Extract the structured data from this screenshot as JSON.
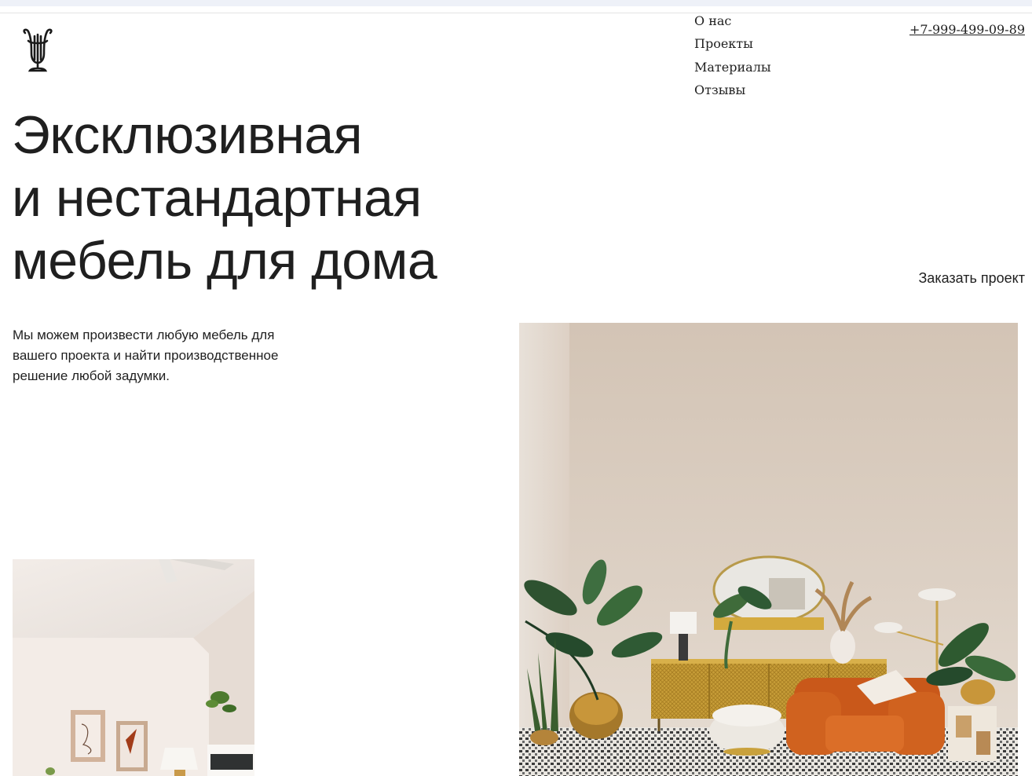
{
  "header": {
    "logo_icon": "lyre-icon",
    "nav": [
      "О нас",
      "Проекты",
      "Материалы",
      "Отзывы"
    ],
    "phone": "+7-999-499-09-89"
  },
  "hero": {
    "title_lines": [
      "Эксклюзивная",
      "и нестандартная",
      "мебель для дома"
    ],
    "order_link": "Заказать проект",
    "lead_lines": [
      "Мы можем произвести любую мебель для",
      "вашего проекта и найти производственное",
      "решение любой задумки."
    ]
  },
  "images": {
    "main": "living-room-photo",
    "secondary": "white-room-photo"
  },
  "colors": {
    "text": "#1f1f1f",
    "wall": "#d8cabd",
    "armchair": "#d0621f",
    "sideboard": "#c9a13c"
  }
}
